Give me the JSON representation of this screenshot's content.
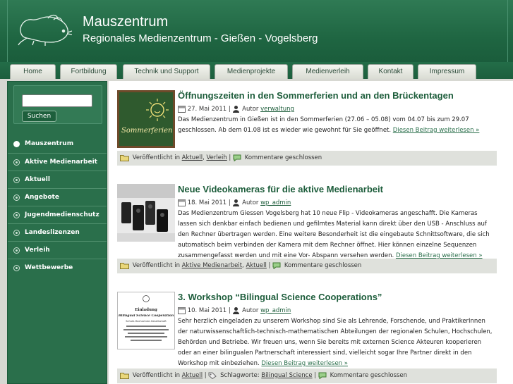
{
  "site": {
    "title": "Mauszentrum",
    "tagline": "Regionales Medienzentrum - Gießen - Vogelsberg"
  },
  "nav": [
    "Home",
    "Fortbildung",
    "Technik und Support",
    "Medienprojekte",
    "Medienverleih",
    "Kontakt",
    "Impressum"
  ],
  "search": {
    "button": "Suchen",
    "value": ""
  },
  "sidebar": [
    {
      "label": "Mauszentrum",
      "current": true
    },
    {
      "label": "Aktive Medienarbeit"
    },
    {
      "label": "Aktuell"
    },
    {
      "label": "Angebote"
    },
    {
      "label": "Jugendmedienschutz"
    },
    {
      "label": "Landeslizenzen"
    },
    {
      "label": "Verleih"
    },
    {
      "label": "Wettbewerbe"
    }
  ],
  "posts": [
    {
      "title": "Öffnungszeiten in den Sommerferien und an den Brückentagen",
      "date": "27. Mai 2011",
      "author_label": "Autor",
      "author": "verwaltung",
      "excerpt": "Das Medienzentrum in Gießen ist in den Sommerferien (27.06 – 05.08) vom 04.07 bis zum 29.07 geschlossen. Ab dem 01.08 ist es wieder wie gewohnt für Sie geöffnet.",
      "more": "Diesen Beitrag weiterlesen »",
      "thumb_text": "Sommerferien",
      "published_label": "Veröffentlicht in",
      "categories": [
        "Aktuell",
        "Verleih"
      ],
      "comments": "Kommentare geschlossen"
    },
    {
      "title": "Neue Videokameras für die aktive Medienarbeit",
      "date": "18. Mai 2011",
      "author_label": "Autor",
      "author": "wp_admin",
      "excerpt": "Das Medienzentrum Giessen Vogelsberg hat 10 neue Flip - Videokameras angeschafft. Die Kameras lassen sich denkbar einfach bedienen und gefilmtes Material kann direkt über den USB - Anschluss auf den Rechner übertragen werden. Eine weitere Besonderheit ist die eingebaute Schnittsoftware, die sich automatisch beim verbinden der Kamera mit dem Rechner öffnet. Hier können einzelne Sequenzen zusammengefasst werden und mit eine Vor- Abspann versehen werden.",
      "more": "Diesen Beitrag weiterlesen »",
      "published_label": "Veröffentlicht in",
      "categories": [
        "Aktive Medienarbeit",
        "Aktuell"
      ],
      "comments": "Kommentare geschlossen"
    },
    {
      "title": "3. Workshop “Bilingual Science Cooperations”",
      "date": "10. Mai 2011",
      "author_label": "Autor",
      "author": "wp_admin",
      "excerpt": "Sehr herzlich eingeladen zu unserem Workshop sind Sie als Lehrende, Forschende, und PraktikerInnen der naturwissenschaftlich-technisch-mathematischen Abteilungen der regionalen Schulen, Hochschulen, Behörden und Betriebe. Wir freuen uns, wenn Sie bereits mit externen Science Akteuren kooperieren oder an einer bilingualen Partnerschaft interessiert sind, vielleicht sogar Ihre Partner direkt in den Workshop mit einbeziehen.",
      "more": "Diesen Beitrag weiterlesen »",
      "thumb_lines": [
        "Einladung",
        "Bilingual Science Cooperation",
        "Schule-Hochschule-Gesellschaft"
      ],
      "published_label": "Veröffentlicht in",
      "categories": [
        "Aktuell"
      ],
      "tags_label": "Schlagworte:",
      "tags": [
        "Bilingual Science"
      ],
      "comments": "Kommentare geschlossen"
    }
  ]
}
